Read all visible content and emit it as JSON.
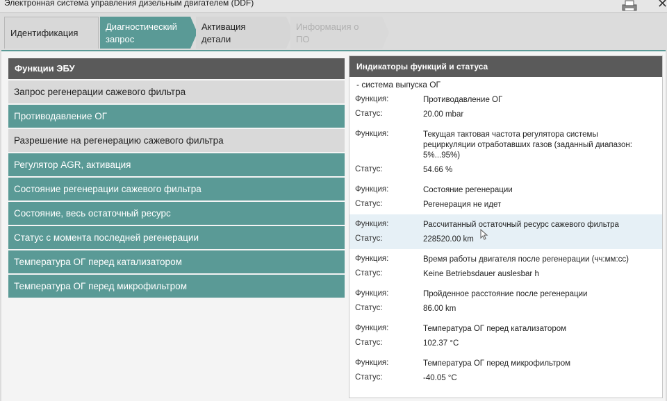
{
  "window": {
    "title": "Электронная система управления дизельным двигателем (DDF)",
    "close_glyph": "✕"
  },
  "tabs": [
    {
      "line1": "Идентификация",
      "line2": ""
    },
    {
      "line1": "Диагностический",
      "line2": "запрос"
    },
    {
      "line1": "Активация",
      "line2": "детали"
    },
    {
      "line1": "Информация о",
      "line2": "ПО"
    }
  ],
  "active_tab_index": 1,
  "colors": {
    "accent": "#5a9a96",
    "header": "#5a5a5a",
    "highlight_row": "#e6f0f6"
  },
  "left": {
    "header": "Функции ЭБУ",
    "items": [
      {
        "label": "Запрос регенерации сажевого фильтра",
        "style": "gray"
      },
      {
        "label": "Противодавление ОГ",
        "style": "teal"
      },
      {
        "label": "Разрешение на регенерацию сажевого фильтра",
        "style": "gray"
      },
      {
        "label": "Регулятор AGR, активация",
        "style": "teal"
      },
      {
        "label": "Состояние регенерации сажевого фильтра",
        "style": "teal"
      },
      {
        "label": "Состояние, весь остаточный ресурс",
        "style": "teal"
      },
      {
        "label": "Статус с момента последней регенерации",
        "style": "teal"
      },
      {
        "label": "Температура ОГ перед катализатором",
        "style": "teal"
      },
      {
        "label": "Температура ОГ перед микрофильтром",
        "style": "teal"
      }
    ]
  },
  "right": {
    "header": "Индикаторы функций и статуса",
    "system": "- система выпуска ОГ",
    "function_key": "Функция:",
    "status_key": "Статус:",
    "entries": [
      {
        "function": "Противодавление ОГ",
        "status": "20.00  mbar"
      },
      {
        "function": "Текущая тактовая частота регулятора системы рециркуляции отработавших газов (заданный диапазон: 5%...95%)",
        "status": "54.66  %"
      },
      {
        "function": "Состояние регенерации",
        "status": "Регенерация не идет"
      },
      {
        "function": "Рассчитанный остаточный ресурс сажевого фильтра",
        "status": "228520.00  km",
        "highlighted": true
      },
      {
        "function": "Время работы двигателя после регенерации (чч:мм:сс)",
        "status": "Keine Betriebsdauer auslesbar  h"
      },
      {
        "function": "Пройденное расстояние после регенерации",
        "status": "86.00  km"
      },
      {
        "function": "Температура ОГ перед катализатором",
        "status": "102.37  °C"
      },
      {
        "function": "Температура ОГ перед микрофильтром",
        "status": "-40.05  °C"
      }
    ]
  }
}
